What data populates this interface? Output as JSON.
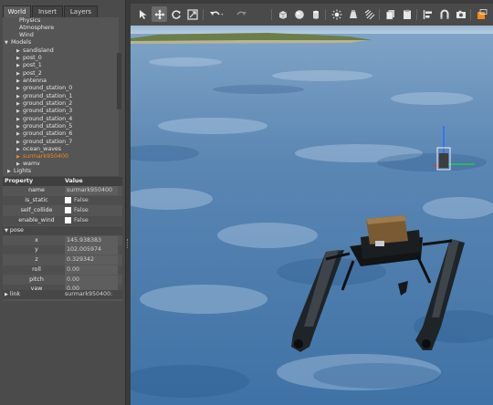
{
  "tabs": [
    {
      "label": "World"
    },
    {
      "label": "Insert"
    },
    {
      "label": "Layers"
    }
  ],
  "tree": {
    "partial_top": "Physics",
    "items": [
      {
        "label": "Atmosphere"
      },
      {
        "label": "Wind"
      },
      {
        "label": "Models"
      },
      {
        "label": "sandisland"
      },
      {
        "label": "post_0"
      },
      {
        "label": "post_1"
      },
      {
        "label": "post_2"
      },
      {
        "label": "antenna"
      },
      {
        "label": "ground_station_0"
      },
      {
        "label": "ground_station_1"
      },
      {
        "label": "ground_station_2"
      },
      {
        "label": "ground_station_3"
      },
      {
        "label": "ground_station_4"
      },
      {
        "label": "ground_station_5"
      },
      {
        "label": "ground_station_6"
      },
      {
        "label": "ground_station_7"
      },
      {
        "label": "ocean_waves"
      },
      {
        "label": "surmark950400"
      },
      {
        "label": "wamv"
      },
      {
        "label": "Lights"
      }
    ]
  },
  "properties": {
    "header_property": "Property",
    "header_value": "Value",
    "rows": [
      {
        "key": "name",
        "value": "surmark950400"
      },
      {
        "key": "is_static",
        "value": "False"
      },
      {
        "key": "self_collide",
        "value": "False"
      },
      {
        "key": "enable_wind",
        "value": "False"
      }
    ],
    "pose_label": "pose",
    "pose": [
      {
        "key": "x",
        "value": "145.938383"
      },
      {
        "key": "y",
        "value": "102.005974"
      },
      {
        "key": "z",
        "value": "0.329342"
      },
      {
        "key": "roll",
        "value": "0.00"
      },
      {
        "key": "pitch",
        "value": "0.00"
      },
      {
        "key": "yaw",
        "value": "0.00"
      }
    ],
    "link_label": "link",
    "link_value": "surmark950400:"
  },
  "toolbar": {
    "icons": [
      "select-mode-icon",
      "translate-mode-icon",
      "rotate-mode-icon",
      "scale-mode-icon",
      "undo-icon",
      "redo-icon",
      "box-icon",
      "sphere-icon",
      "cylinder-icon",
      "point-light-icon",
      "spot-light-icon",
      "directional-light-icon",
      "copy-icon",
      "paste-icon",
      "align-icon",
      "snap-icon",
      "screenshot-icon",
      "record-icon"
    ]
  },
  "colors": {
    "selected_item": "#f08a1e",
    "panel_bg": "#4b4b4b",
    "water": "#3f75a8",
    "sky": "#5f8bb8"
  }
}
